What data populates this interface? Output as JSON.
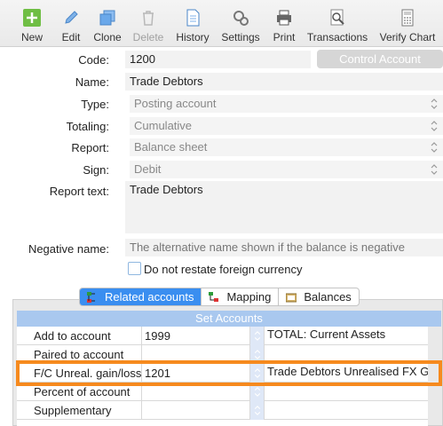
{
  "toolbar": {
    "items": [
      {
        "label": "New",
        "icon": "plus-icon",
        "enabled": true
      },
      {
        "label": "Edit",
        "icon": "pencil-icon",
        "enabled": true
      },
      {
        "label": "Clone",
        "icon": "clone-icon",
        "enabled": true
      },
      {
        "label": "Delete",
        "icon": "trash-icon",
        "enabled": false
      },
      {
        "label": "History",
        "icon": "document-icon",
        "enabled": true
      },
      {
        "label": "Settings",
        "icon": "gears-icon",
        "enabled": true
      },
      {
        "label": "Print",
        "icon": "printer-icon",
        "enabled": true
      },
      {
        "label": "Transactions",
        "icon": "magnifier-icon",
        "enabled": true
      },
      {
        "label": "Verify Chart",
        "icon": "calculator-icon",
        "enabled": true
      }
    ]
  },
  "form": {
    "code_label": "Code:",
    "code_value": "1200",
    "control_account_label": "Control Account",
    "name_label": "Name:",
    "name_value": "Trade Debtors",
    "type_label": "Type:",
    "type_value": "Posting account",
    "totaling_label": "Totaling:",
    "totaling_value": "Cumulative",
    "report_label": "Report:",
    "report_value": "Balance sheet",
    "sign_label": "Sign:",
    "sign_value": "Debit",
    "report_text_label": "Report text:",
    "report_text_value": "Trade Debtors",
    "negative_name_label": "Negative name:",
    "negative_name_placeholder": "The alternative name shown if the balance is negative",
    "restate_label": "Do not restate foreign currency"
  },
  "tabs": {
    "related": "Related accounts",
    "mapping": "Mapping",
    "balances": "Balances"
  },
  "set_accounts": {
    "title": "Set Accounts",
    "rows": [
      {
        "label": "Add to account",
        "code": "1999",
        "description": "TOTAL: Current Assets"
      },
      {
        "label": "Paired to account",
        "code": "",
        "description": ""
      },
      {
        "label": "F/C Unreal. gain/loss",
        "code": "1201",
        "description": "Trade Debtors Unrealised FX Ga"
      },
      {
        "label": "Percent of account",
        "code": "",
        "description": ""
      },
      {
        "label": "Supplementary",
        "code": "",
        "description": ""
      }
    ]
  },
  "colors": {
    "accent": "#3a8ef0",
    "highlight": "#f68a1e",
    "header": "#a9c8ef"
  }
}
